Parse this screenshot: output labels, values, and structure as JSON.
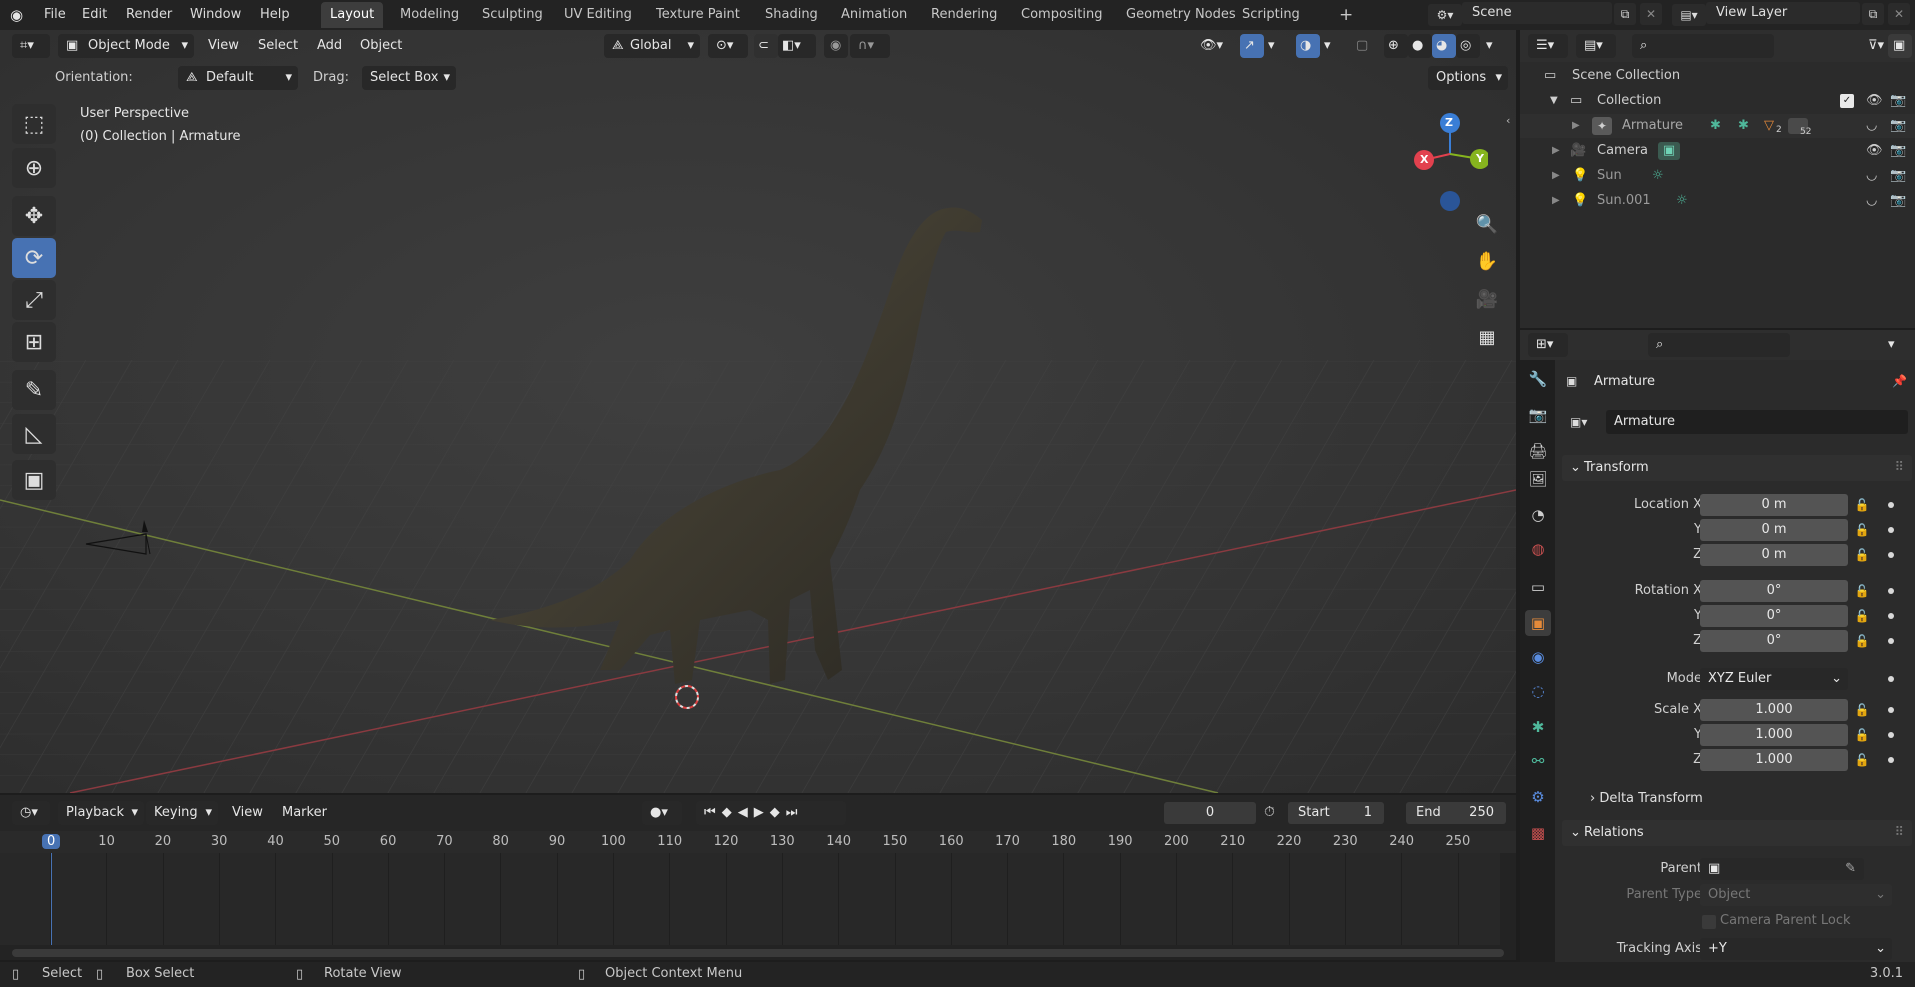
{
  "app": {
    "name": "Blender",
    "version": "3.0.1"
  },
  "topbar": {
    "menus": [
      "File",
      "Edit",
      "Render",
      "Window",
      "Help"
    ],
    "workspaces": [
      "Layout",
      "Modeling",
      "Sculpting",
      "UV Editing",
      "Texture Paint",
      "Shading",
      "Animation",
      "Rendering",
      "Compositing",
      "Geometry Nodes",
      "Scripting"
    ],
    "active_workspace": "Layout",
    "add_workspace": "+",
    "scene": "Scene",
    "view_layer": "View Layer"
  },
  "viewport": {
    "mode": "Object Mode",
    "menus": [
      "View",
      "Select",
      "Add",
      "Object"
    ],
    "transform_orientation": "Global",
    "orientation_label": "Orientation:",
    "orientation_value": "Default",
    "drag_label": "Drag:",
    "drag_value": "Select Box",
    "options": "Options",
    "overlay_title": "User Perspective",
    "overlay_subtitle": "(0) Collection | Armature",
    "gizmo": {
      "x": "X",
      "y": "Y",
      "z": "Z"
    }
  },
  "timeline": {
    "menus": [
      "Playback",
      "Keying",
      "View",
      "Marker"
    ],
    "current_frame": "0",
    "start_label": "Start",
    "start": "1",
    "end_label": "End",
    "end": "250",
    "ruler": [
      "0",
      "10",
      "20",
      "30",
      "40",
      "50",
      "60",
      "70",
      "80",
      "90",
      "100",
      "110",
      "120",
      "130",
      "140",
      "150",
      "160",
      "170",
      "180",
      "190",
      "200",
      "210",
      "220",
      "230",
      "240",
      "250"
    ]
  },
  "statusbar": {
    "items": [
      "Select",
      "Box Select",
      "Rotate View",
      "Object Context Menu"
    ],
    "version": "3.0.1"
  },
  "outliner": {
    "root": "Scene Collection",
    "collection": "Collection",
    "items": [
      {
        "name": "Armature",
        "badge1": "2",
        "badge2": "52"
      },
      {
        "name": "Camera"
      },
      {
        "name": "Sun"
      },
      {
        "name": "Sun.001"
      }
    ]
  },
  "properties": {
    "object_name": "Armature",
    "datablock": "Armature",
    "transform": {
      "title": "Transform",
      "location_label": "Location X",
      "y_label": "Y",
      "z_label": "Z",
      "location": [
        "0 m",
        "0 m",
        "0 m"
      ],
      "rotation_label": "Rotation X",
      "rotation": [
        "0°",
        "0°",
        "0°"
      ],
      "mode_label": "Mode",
      "mode": "XYZ Euler",
      "scale_label": "Scale X",
      "scale": [
        "1.000",
        "1.000",
        "1.000"
      ]
    },
    "delta_transform": "Delta Transform",
    "relations": {
      "title": "Relations",
      "parent_label": "Parent",
      "parent_type_label": "Parent Type",
      "parent_type": "Object",
      "camera_parent_lock": "Camera Parent Lock",
      "tracking_axis_label": "Tracking Axis",
      "tracking_axis": "+Y"
    }
  },
  "colors": {
    "accent": "#4772b3",
    "x_axis": "#e2414e",
    "y_axis": "#86b41e",
    "z_axis": "#3a7ed6",
    "timeline_frame": "#4772b3"
  }
}
